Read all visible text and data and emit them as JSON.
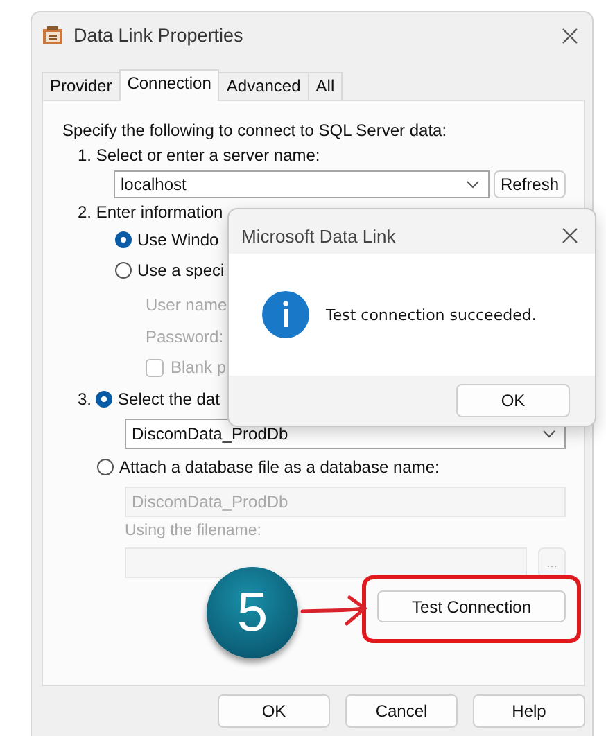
{
  "window": {
    "title": "Data Link Properties"
  },
  "tabs": [
    {
      "label": "Provider",
      "selected": false
    },
    {
      "label": "Connection",
      "selected": true
    },
    {
      "label": "Advanced",
      "selected": false
    },
    {
      "label": "All",
      "selected": false
    }
  ],
  "intro": "Specify the following to connect to SQL Server data:",
  "step_1": {
    "label": "1. Select or enter a server name:",
    "server": "localhost",
    "refresh_button": "Refresh"
  },
  "step_2": {
    "label": "2. Enter information",
    "options": [
      {
        "label": "Use Windo",
        "selected": true
      },
      {
        "label": "Use a speci",
        "selected": false
      }
    ],
    "credentials_disabled": true,
    "user_name_label": "User name",
    "password_label": "Password:",
    "blank_password": {
      "label": "Blank p",
      "checked": false
    }
  },
  "step_3": {
    "number": "3.",
    "select_option": {
      "label": "Select the dat",
      "selected": true
    },
    "database": "DiscomData_ProdDb",
    "attach_option": {
      "label": "Attach a database file as a database name:",
      "selected": false
    },
    "attach_disabled": true,
    "attach_name": "DiscomData_ProdDb",
    "filename_label": "Using the filename:",
    "browse_button": "..."
  },
  "test_button": "Test Connection",
  "step_badge": "5",
  "buttons": [
    "OK",
    "Cancel",
    "Help"
  ],
  "message_box": {
    "title": "Microsoft Data Link",
    "message": "Test connection succeeded.",
    "button": "OK"
  }
}
